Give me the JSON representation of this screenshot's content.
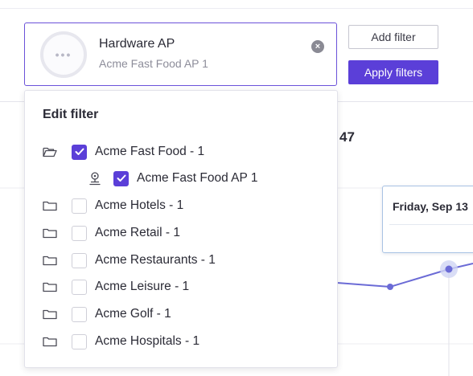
{
  "filter_chip": {
    "title": "Hardware AP",
    "subtitle": "Acme Fast Food AP 1",
    "avatar_glyph": "•••",
    "clear_icon": "×"
  },
  "toolbar": {
    "add_filter_label": "Add filter",
    "apply_filters_label": "Apply filters"
  },
  "background": {
    "kpi_partial": "47",
    "tooltip_title": "Friday, Sep 13"
  },
  "edit_filter": {
    "title": "Edit filter",
    "items": [
      {
        "label": "Acme Fast Food - 1",
        "checked": true,
        "icon": "folder-open-icon",
        "level": 0
      },
      {
        "label": "Acme Fast Food AP 1",
        "checked": true,
        "icon": "access-point-icon",
        "level": 1
      },
      {
        "label": "Acme Hotels - 1",
        "checked": false,
        "icon": "folder-icon",
        "level": 0
      },
      {
        "label": "Acme Retail - 1",
        "checked": false,
        "icon": "folder-icon",
        "level": 0
      },
      {
        "label": "Acme Restaurants - 1",
        "checked": false,
        "icon": "folder-icon",
        "level": 0
      },
      {
        "label": "Acme Leisure - 1",
        "checked": false,
        "icon": "folder-icon",
        "level": 0
      },
      {
        "label": "Acme Golf - 1",
        "checked": false,
        "icon": "folder-icon",
        "level": 0
      },
      {
        "label": "Acme Hospitals - 1",
        "checked": false,
        "icon": "folder-icon",
        "level": 0
      }
    ]
  },
  "colors": {
    "accent": "#5b3fd8",
    "chart_line": "#6b6bd6"
  }
}
